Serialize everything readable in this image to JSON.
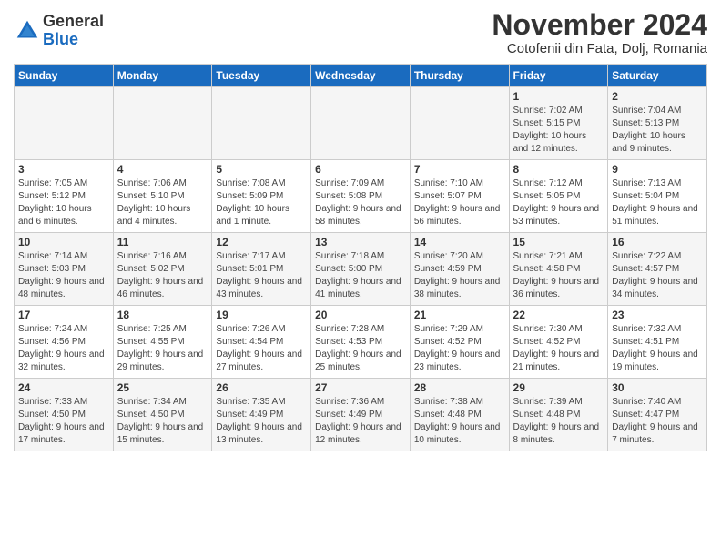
{
  "header": {
    "logo_general": "General",
    "logo_blue": "Blue",
    "month_title": "November 2024",
    "subtitle": "Cotofenii din Fata, Dolj, Romania"
  },
  "calendar": {
    "headers": [
      "Sunday",
      "Monday",
      "Tuesday",
      "Wednesday",
      "Thursday",
      "Friday",
      "Saturday"
    ],
    "weeks": [
      [
        {
          "day": "",
          "info": ""
        },
        {
          "day": "",
          "info": ""
        },
        {
          "day": "",
          "info": ""
        },
        {
          "day": "",
          "info": ""
        },
        {
          "day": "",
          "info": ""
        },
        {
          "day": "1",
          "info": "Sunrise: 7:02 AM\nSunset: 5:15 PM\nDaylight: 10 hours and 12 minutes."
        },
        {
          "day": "2",
          "info": "Sunrise: 7:04 AM\nSunset: 5:13 PM\nDaylight: 10 hours and 9 minutes."
        }
      ],
      [
        {
          "day": "3",
          "info": "Sunrise: 7:05 AM\nSunset: 5:12 PM\nDaylight: 10 hours and 6 minutes."
        },
        {
          "day": "4",
          "info": "Sunrise: 7:06 AM\nSunset: 5:10 PM\nDaylight: 10 hours and 4 minutes."
        },
        {
          "day": "5",
          "info": "Sunrise: 7:08 AM\nSunset: 5:09 PM\nDaylight: 10 hours and 1 minute."
        },
        {
          "day": "6",
          "info": "Sunrise: 7:09 AM\nSunset: 5:08 PM\nDaylight: 9 hours and 58 minutes."
        },
        {
          "day": "7",
          "info": "Sunrise: 7:10 AM\nSunset: 5:07 PM\nDaylight: 9 hours and 56 minutes."
        },
        {
          "day": "8",
          "info": "Sunrise: 7:12 AM\nSunset: 5:05 PM\nDaylight: 9 hours and 53 minutes."
        },
        {
          "day": "9",
          "info": "Sunrise: 7:13 AM\nSunset: 5:04 PM\nDaylight: 9 hours and 51 minutes."
        }
      ],
      [
        {
          "day": "10",
          "info": "Sunrise: 7:14 AM\nSunset: 5:03 PM\nDaylight: 9 hours and 48 minutes."
        },
        {
          "day": "11",
          "info": "Sunrise: 7:16 AM\nSunset: 5:02 PM\nDaylight: 9 hours and 46 minutes."
        },
        {
          "day": "12",
          "info": "Sunrise: 7:17 AM\nSunset: 5:01 PM\nDaylight: 9 hours and 43 minutes."
        },
        {
          "day": "13",
          "info": "Sunrise: 7:18 AM\nSunset: 5:00 PM\nDaylight: 9 hours and 41 minutes."
        },
        {
          "day": "14",
          "info": "Sunrise: 7:20 AM\nSunset: 4:59 PM\nDaylight: 9 hours and 38 minutes."
        },
        {
          "day": "15",
          "info": "Sunrise: 7:21 AM\nSunset: 4:58 PM\nDaylight: 9 hours and 36 minutes."
        },
        {
          "day": "16",
          "info": "Sunrise: 7:22 AM\nSunset: 4:57 PM\nDaylight: 9 hours and 34 minutes."
        }
      ],
      [
        {
          "day": "17",
          "info": "Sunrise: 7:24 AM\nSunset: 4:56 PM\nDaylight: 9 hours and 32 minutes."
        },
        {
          "day": "18",
          "info": "Sunrise: 7:25 AM\nSunset: 4:55 PM\nDaylight: 9 hours and 29 minutes."
        },
        {
          "day": "19",
          "info": "Sunrise: 7:26 AM\nSunset: 4:54 PM\nDaylight: 9 hours and 27 minutes."
        },
        {
          "day": "20",
          "info": "Sunrise: 7:28 AM\nSunset: 4:53 PM\nDaylight: 9 hours and 25 minutes."
        },
        {
          "day": "21",
          "info": "Sunrise: 7:29 AM\nSunset: 4:52 PM\nDaylight: 9 hours and 23 minutes."
        },
        {
          "day": "22",
          "info": "Sunrise: 7:30 AM\nSunset: 4:52 PM\nDaylight: 9 hours and 21 minutes."
        },
        {
          "day": "23",
          "info": "Sunrise: 7:32 AM\nSunset: 4:51 PM\nDaylight: 9 hours and 19 minutes."
        }
      ],
      [
        {
          "day": "24",
          "info": "Sunrise: 7:33 AM\nSunset: 4:50 PM\nDaylight: 9 hours and 17 minutes."
        },
        {
          "day": "25",
          "info": "Sunrise: 7:34 AM\nSunset: 4:50 PM\nDaylight: 9 hours and 15 minutes."
        },
        {
          "day": "26",
          "info": "Sunrise: 7:35 AM\nSunset: 4:49 PM\nDaylight: 9 hours and 13 minutes."
        },
        {
          "day": "27",
          "info": "Sunrise: 7:36 AM\nSunset: 4:49 PM\nDaylight: 9 hours and 12 minutes."
        },
        {
          "day": "28",
          "info": "Sunrise: 7:38 AM\nSunset: 4:48 PM\nDaylight: 9 hours and 10 minutes."
        },
        {
          "day": "29",
          "info": "Sunrise: 7:39 AM\nSunset: 4:48 PM\nDaylight: 9 hours and 8 minutes."
        },
        {
          "day": "30",
          "info": "Sunrise: 7:40 AM\nSunset: 4:47 PM\nDaylight: 9 hours and 7 minutes."
        }
      ]
    ]
  }
}
